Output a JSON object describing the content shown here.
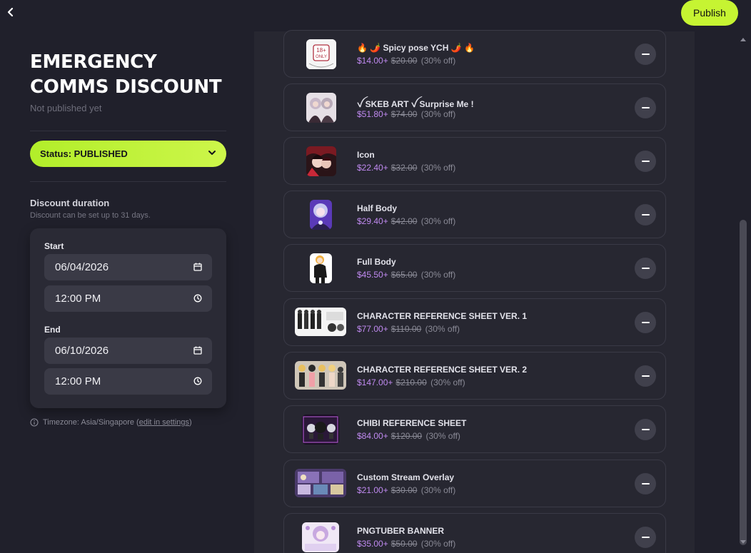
{
  "header": {
    "publish_label": "Publish"
  },
  "discount": {
    "title": "EMERGENCY COMMS DISCOUNT",
    "subtitle": "Not published yet",
    "status_label": "Status: PUBLISHED",
    "duration_label": "Discount duration",
    "duration_hint": "Discount can be set up to 31 days.",
    "start_label": "Start",
    "start_date": "06/04/2026",
    "start_time": "12:00 PM",
    "end_label": "End",
    "end_date": "06/10/2026",
    "end_time": "12:00 PM",
    "timezone_text": "Timezone: Asia/Singapore (",
    "timezone_link": "edit in settings",
    "timezone_close": ")"
  },
  "colors": {
    "accent": "#c6f432",
    "price": "#c08af0",
    "background": "#20202b",
    "panel": "#272731"
  },
  "items": [
    {
      "name": "🔥 🌶️ Spicy pose YCH 🌶️ 🔥",
      "price": "$14.00+",
      "original": "$20.00",
      "off": "(30% off)",
      "icon": "thumbnail-18plus"
    },
    {
      "name": "ꪜ SKEB ART ꪜ Surprise Me !",
      "price": "$51.80+",
      "original": "$74.00",
      "off": "(30% off)",
      "icon": "thumbnail-duo"
    },
    {
      "name": "Icon",
      "price": "$22.40+",
      "original": "$32.00",
      "off": "(30% off)",
      "icon": "thumbnail-icon"
    },
    {
      "name": "Half Body",
      "price": "$29.40+",
      "original": "$42.00",
      "off": "(30% off)",
      "icon": "thumbnail-halfbody"
    },
    {
      "name": "Full Body",
      "price": "$45.50+",
      "original": "$65.00",
      "off": "(30% off)",
      "icon": "thumbnail-fullbody"
    },
    {
      "name": "CHARACTER REFERENCE SHEET VER. 1",
      "price": "$77.00+",
      "original": "$110.00",
      "off": "(30% off)",
      "icon": "thumbnail-refsheet-1"
    },
    {
      "name": "CHARACTER REFERENCE SHEET VER. 2",
      "price": "$147.00+",
      "original": "$210.00",
      "off": "(30% off)",
      "icon": "thumbnail-refsheet-2"
    },
    {
      "name": "CHIBI REFERENCE SHEET",
      "price": "$84.00+",
      "original": "$120.00",
      "off": "(30% off)",
      "icon": "thumbnail-chibi"
    },
    {
      "name": "Custom Stream Overlay",
      "price": "$21.00+",
      "original": "$30.00",
      "off": "(30% off)",
      "icon": "thumbnail-overlay"
    },
    {
      "name": "PNGTUBER BANNER",
      "price": "$35.00+",
      "original": "$50.00",
      "off": "(30% off)",
      "icon": "thumbnail-banner"
    }
  ]
}
